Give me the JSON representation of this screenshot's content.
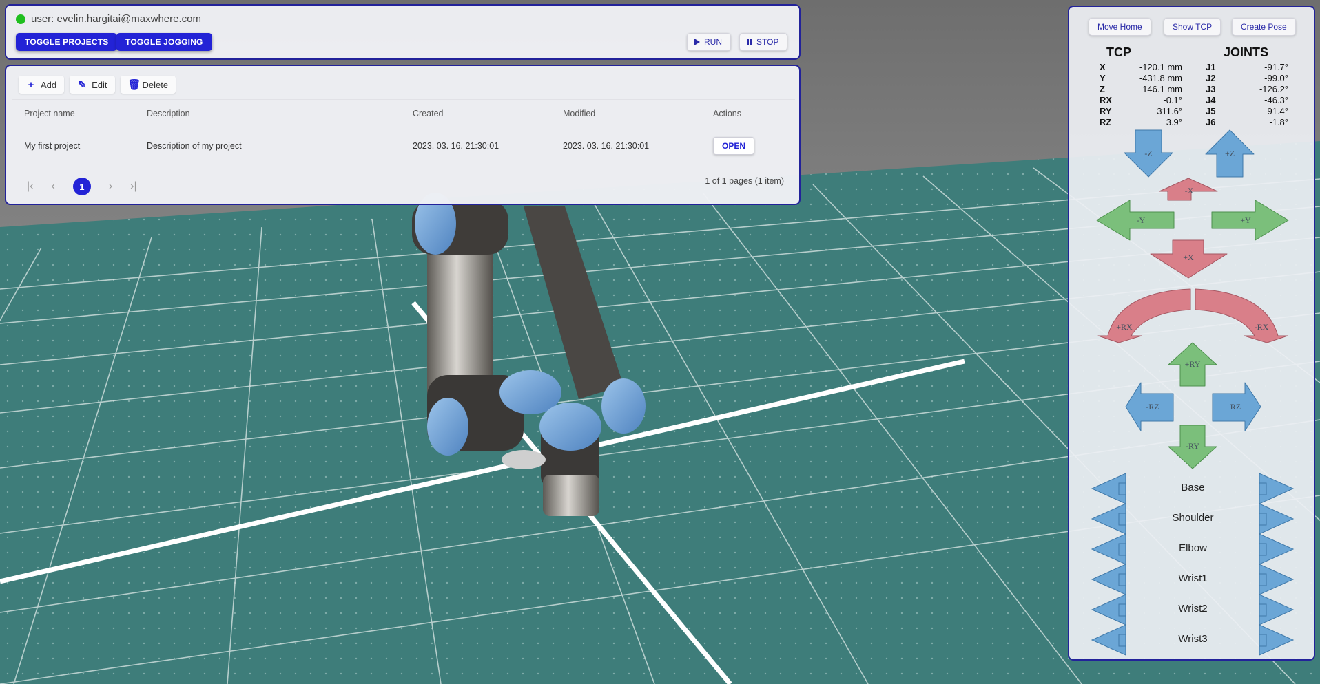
{
  "top_bar": {
    "user_text": "user: evelin.hargitai@maxwhere.com",
    "toggle_projects": "TOGGLE PROJECTS",
    "toggle_jogging": "TOGGLE JOGGING",
    "run": "RUN",
    "stop": "STOP"
  },
  "projects": {
    "toolbar": {
      "add": "Add",
      "edit": "Edit",
      "delete": "Delete"
    },
    "columns": [
      "Project name",
      "Description",
      "Created",
      "Modified",
      "Actions"
    ],
    "rows": [
      {
        "name": "My first project",
        "description": "Description of my project",
        "created": "2023. 03. 16. 21:30:01",
        "modified": "2023. 03. 16. 21:30:01",
        "action": "OPEN"
      }
    ],
    "pager": {
      "current_page": "1",
      "info": "1 of 1 pages (1 item)"
    }
  },
  "jogging": {
    "buttons": {
      "move_home": "Move Home",
      "show_tcp": "Show TCP",
      "create_pose": "Create Pose"
    },
    "tcp": {
      "title": "TCP",
      "rows": [
        {
          "k": "X",
          "v": "-120.1 mm"
        },
        {
          "k": "Y",
          "v": "-431.8 mm"
        },
        {
          "k": "Z",
          "v": "146.1 mm"
        },
        {
          "k": "RX",
          "v": "-0.1°"
        },
        {
          "k": "RY",
          "v": "311.6°"
        },
        {
          "k": "RZ",
          "v": "3.9°"
        }
      ]
    },
    "joints": {
      "title": "JOINTS",
      "rows": [
        {
          "k": "J1",
          "v": "-91.7°"
        },
        {
          "k": "J2",
          "v": "-99.0°"
        },
        {
          "k": "J3",
          "v": "-126.2°"
        },
        {
          "k": "J4",
          "v": "-46.3°"
        },
        {
          "k": "J5",
          "v": "91.4°"
        },
        {
          "k": "J6",
          "v": "-1.8°"
        }
      ]
    },
    "arrow_labels": {
      "minus_z": "-Z",
      "plus_z": "+Z",
      "minus_x": "-X",
      "minus_y": "-Y",
      "plus_y": "+Y",
      "plus_x": "+X",
      "plus_rx": "+RX",
      "minus_rx": "-RX",
      "plus_ry": "+RY",
      "minus_ry": "-RY",
      "minus_rz": "-RZ",
      "plus_rz": "+RZ"
    },
    "joint_names": [
      "Base",
      "Shoulder",
      "Elbow",
      "Wrist1",
      "Wrist2",
      "Wrist3"
    ]
  },
  "colors": {
    "accent": "#2323d6",
    "panel_border": "#22229a",
    "arrow_blue": "#6ba6d6",
    "arrow_red": "#d97f89",
    "arrow_green": "#7bbf7b",
    "floor": "#3e7d7a"
  }
}
